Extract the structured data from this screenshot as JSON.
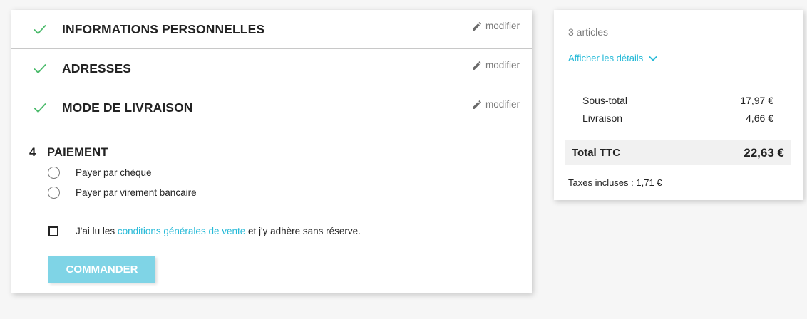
{
  "colors": {
    "accent": "#24b9d7",
    "button": "#7fd4e6",
    "check": "#4cbb6c",
    "muted": "#7a7a7a",
    "text": "#232323"
  },
  "steps": [
    {
      "title": "INFORMATIONS PERSONNELLES",
      "status_icon": "check-icon",
      "edit_label": "modifier"
    },
    {
      "title": "ADRESSES",
      "status_icon": "check-icon",
      "edit_label": "modifier"
    },
    {
      "title": "MODE DE LIVRAISON",
      "status_icon": "check-icon",
      "edit_label": "modifier"
    }
  ],
  "payment": {
    "step_number": "4",
    "title": "PAIEMENT",
    "options": [
      {
        "label": "Payer par chèque",
        "selected": false
      },
      {
        "label": "Payer par virement bancaire",
        "selected": false
      }
    ],
    "terms": {
      "prefix": "J'ai lu les ",
      "link": "conditions générales de vente",
      "suffix": " et j'y adhère sans réserve.",
      "checked": false
    },
    "order_button": "COMMANDER"
  },
  "summary": {
    "items_count": "3 articles",
    "details_label": "Afficher les détails",
    "subtotal_label": "Sous-total",
    "subtotal_value": "17,97 €",
    "shipping_label": "Livraison",
    "shipping_value": "4,66 €",
    "total_label": "Total TTC",
    "total_value": "22,63 €",
    "taxes": "Taxes incluses : 1,71 €"
  }
}
